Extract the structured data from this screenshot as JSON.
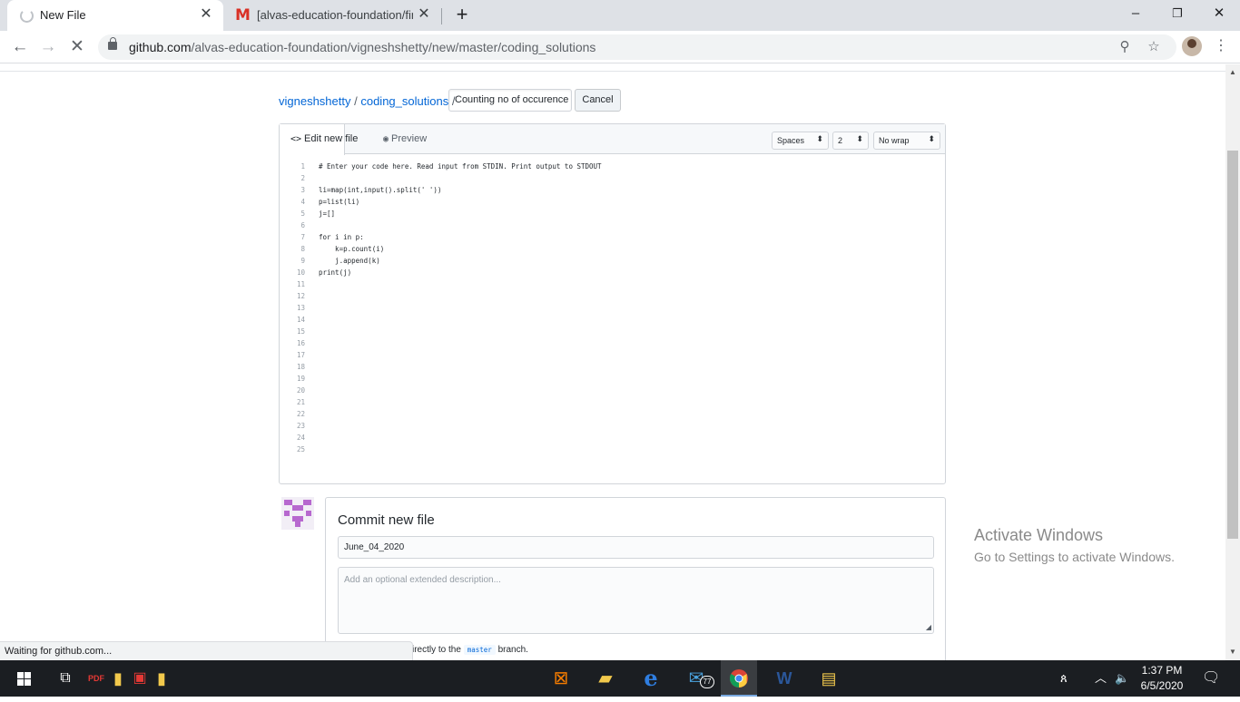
{
  "browser": {
    "tabs": [
      {
        "title": "New File",
        "active": true,
        "close": "✕"
      },
      {
        "title": "[alvas-education-foundation/fina",
        "active": false,
        "close": "✕"
      }
    ],
    "new_tab": "+",
    "window_controls": {
      "minimize": "–",
      "maximize": "❐",
      "close": "✕"
    },
    "url_host": "github.com",
    "url_path": "/alvas-education-foundation/vigneshshetty/new/master/coding_solutions",
    "status_text": "Waiting for github.com..."
  },
  "breadcrumb": {
    "owner": "vigneshshetty",
    "sep1": " / ",
    "folder": "coding_solutions",
    "sep2": " /"
  },
  "filename_value": "Counting no of occurence",
  "cancel_label": "Cancel",
  "editor": {
    "tab_edit": "Edit new file",
    "tab_preview": "Preview",
    "indent_mode": "Spaces",
    "indent_size": "2",
    "wrap_mode": "No wrap",
    "lines": [
      "# Enter your code here. Read input from STDIN. Print output to STDOUT",
      "",
      "li=map(int,input().split(' '))",
      "p=list(li)",
      "j=[]",
      "",
      "for i in p:",
      "    k=p.count(i)",
      "    j.append(k)",
      "print(j)",
      "",
      "",
      "",
      "",
      "",
      "",
      "",
      "",
      "",
      "",
      "",
      "",
      "",
      "",
      ""
    ]
  },
  "commit": {
    "title": "Commit new file",
    "summary_value": "June_04_2020",
    "description_placeholder": "Add an optional extended description...",
    "direct_prefix": "irectly to the ",
    "branch": "master",
    "direct_suffix": " branch."
  },
  "watermark": {
    "line1": "Activate Windows",
    "line2": "Go to Settings to activate Windows."
  },
  "taskbar": {
    "mail_badge": "77",
    "time": "1:37 PM",
    "date": "6/5/2020"
  }
}
